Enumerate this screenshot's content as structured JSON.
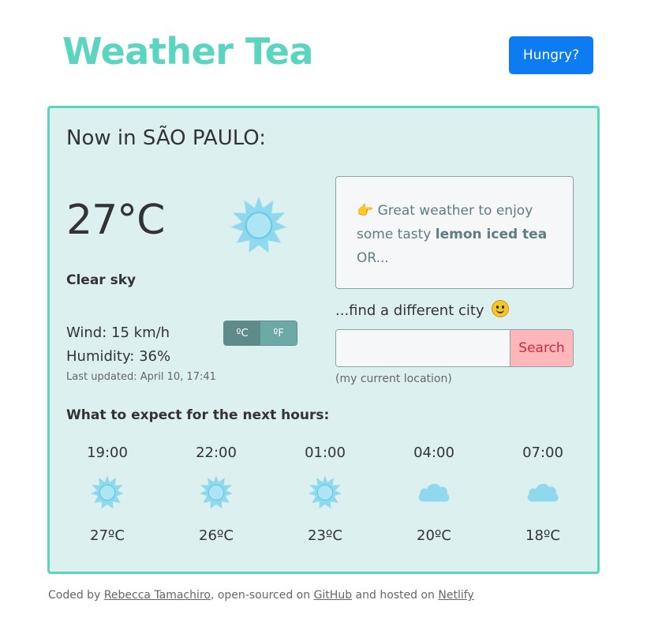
{
  "header": {
    "title": "Weather Tea",
    "hungry_label": "Hungry?"
  },
  "current": {
    "heading": "Now in SÃO PAULO:",
    "temperature": "27°C",
    "icon": "sun-icon",
    "description": "Clear sky",
    "wind": "Wind: 15 km/h",
    "humidity": "Humidity: 36%",
    "last_updated": "Last updated: April 10, 17:41",
    "unit_c": "ºC",
    "unit_f": "ºF"
  },
  "tea": {
    "pointer": "👉",
    "prefix": " Great weather to enjoy some tasty ",
    "drink": "lemon iced tea",
    "suffix": " OR..."
  },
  "search": {
    "find_text": "...find a different city",
    "placeholder": "",
    "value": "",
    "button_label": "Search",
    "current_location": "(my current location)"
  },
  "forecast": {
    "title": "What to expect for the next hours:",
    "items": [
      {
        "time": "19:00",
        "icon": "sun-icon",
        "temp": "27ºC"
      },
      {
        "time": "22:00",
        "icon": "sun-icon",
        "temp": "26ºC"
      },
      {
        "time": "01:00",
        "icon": "sun-icon",
        "temp": "23ºC"
      },
      {
        "time": "04:00",
        "icon": "cloud-icon",
        "temp": "20ºC"
      },
      {
        "time": "07:00",
        "icon": "cloud-icon",
        "temp": "18ºC"
      }
    ]
  },
  "footer": {
    "coded_by": "Coded by ",
    "author": "Rebecca Tamachiro",
    "open_sourced": ", open-sourced on ",
    "github": "GitHub",
    "hosted": " and hosted on ",
    "netlify": "Netlify"
  },
  "colors": {
    "brand": "#5bd4c0",
    "card_bg": "#ddf0f0",
    "hungry_button": "#0d7cf2",
    "search_button": "#ffb7bb",
    "icon": "#8fd9ee"
  }
}
